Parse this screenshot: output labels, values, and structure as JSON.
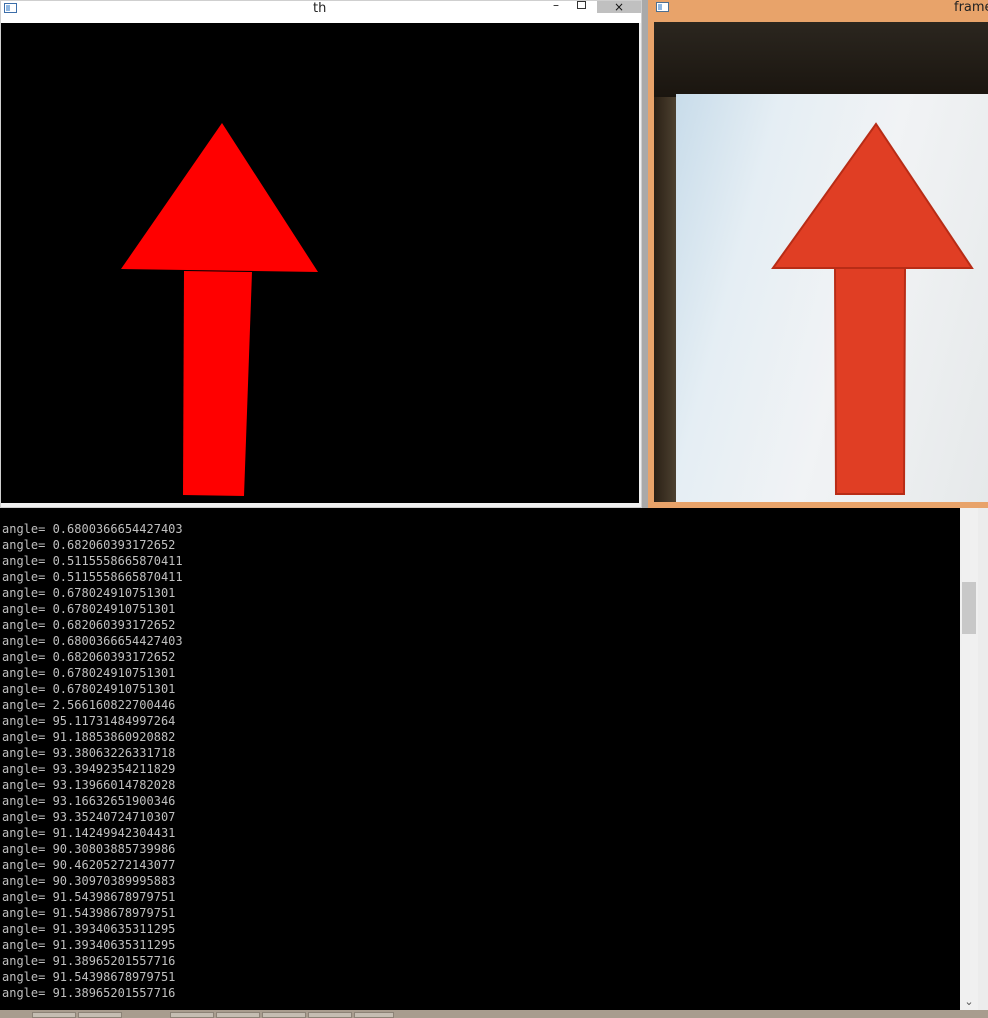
{
  "windows": {
    "th": {
      "title": "th",
      "close_label": "×",
      "min_label": "–",
      "icon": "window-icon"
    },
    "frame": {
      "title": "frame",
      "icon": "window-icon"
    }
  },
  "colors": {
    "threshold_red": "#ff0000",
    "photo_red": "#e03e24",
    "frame_border": "#e8a36a",
    "console_bg": "#000000",
    "console_text": "#c0c0c0"
  },
  "console": {
    "lines": [
      "angle= 0.6800366654427403",
      "angle= 0.682060393172652",
      "angle= 0.5115558665870411",
      "angle= 0.5115558665870411",
      "angle= 0.678024910751301",
      "angle= 0.678024910751301",
      "angle= 0.682060393172652",
      "angle= 0.6800366654427403",
      "angle= 0.682060393172652",
      "angle= 0.678024910751301",
      "angle= 0.678024910751301",
      "angle= 2.566160822700446",
      "angle= 95.11731484997264",
      "angle= 91.18853860920882",
      "angle= 93.38063226331718",
      "angle= 93.39492354211829",
      "angle= 93.13966014782028",
      "angle= 93.16632651900346",
      "angle= 93.35240724710307",
      "angle= 91.14249942304431",
      "angle= 90.30803885739986",
      "angle= 90.46205272143077",
      "angle= 90.30970389995883",
      "angle= 91.54398678979751",
      "angle= 91.54398678979751",
      "angle= 91.39340635311295",
      "angle= 91.39340635311295",
      "angle= 91.38965201557716",
      "angle= 91.54398678979751",
      "angle= 91.38965201557716"
    ],
    "scroll_down_icon": "chevron-down-icon",
    "scroll_down_glyph": "⌄"
  }
}
